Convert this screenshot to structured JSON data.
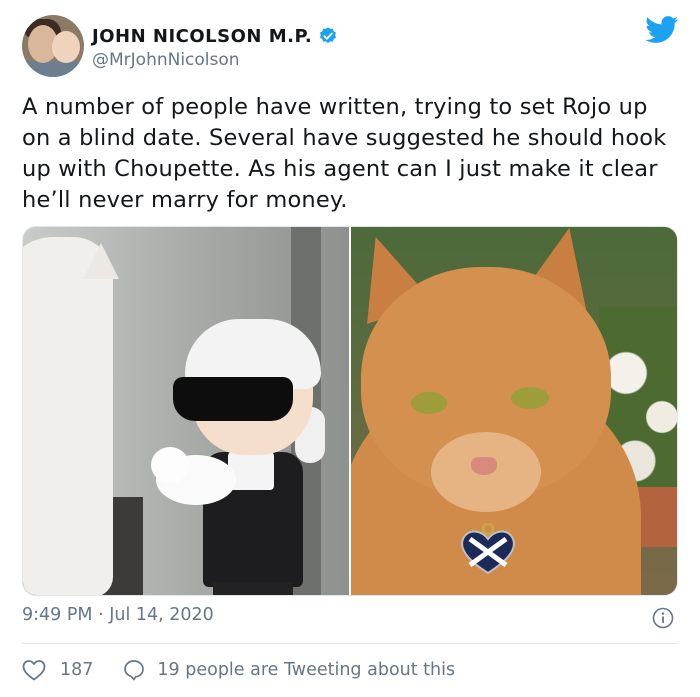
{
  "author": {
    "display_name": "JOHN NICOLSON M.P.",
    "handle": "@MrJohnNicolson",
    "verified": true
  },
  "tweet": {
    "text": "A number of people have written, trying to set Rojo up on a blind date. Several have suggested he should hook up with Choupette. As his agent can I just make it clear he’ll never marry for money.",
    "timestamp": "9:49 PM · Jul 14, 2020"
  },
  "engagement": {
    "likes": "187",
    "conversation_text": "19 people are Tweeting about this"
  },
  "icons": {
    "brand": "twitter-bird-icon",
    "verified": "verified-badge-icon",
    "info": "info-icon",
    "like": "heart-icon",
    "reply": "speech-bubble-icon"
  },
  "colors": {
    "twitter_blue": "#1da1f2",
    "secondary_text": "#657786",
    "primary_text": "#14171a",
    "divider": "#e1e8ed"
  }
}
